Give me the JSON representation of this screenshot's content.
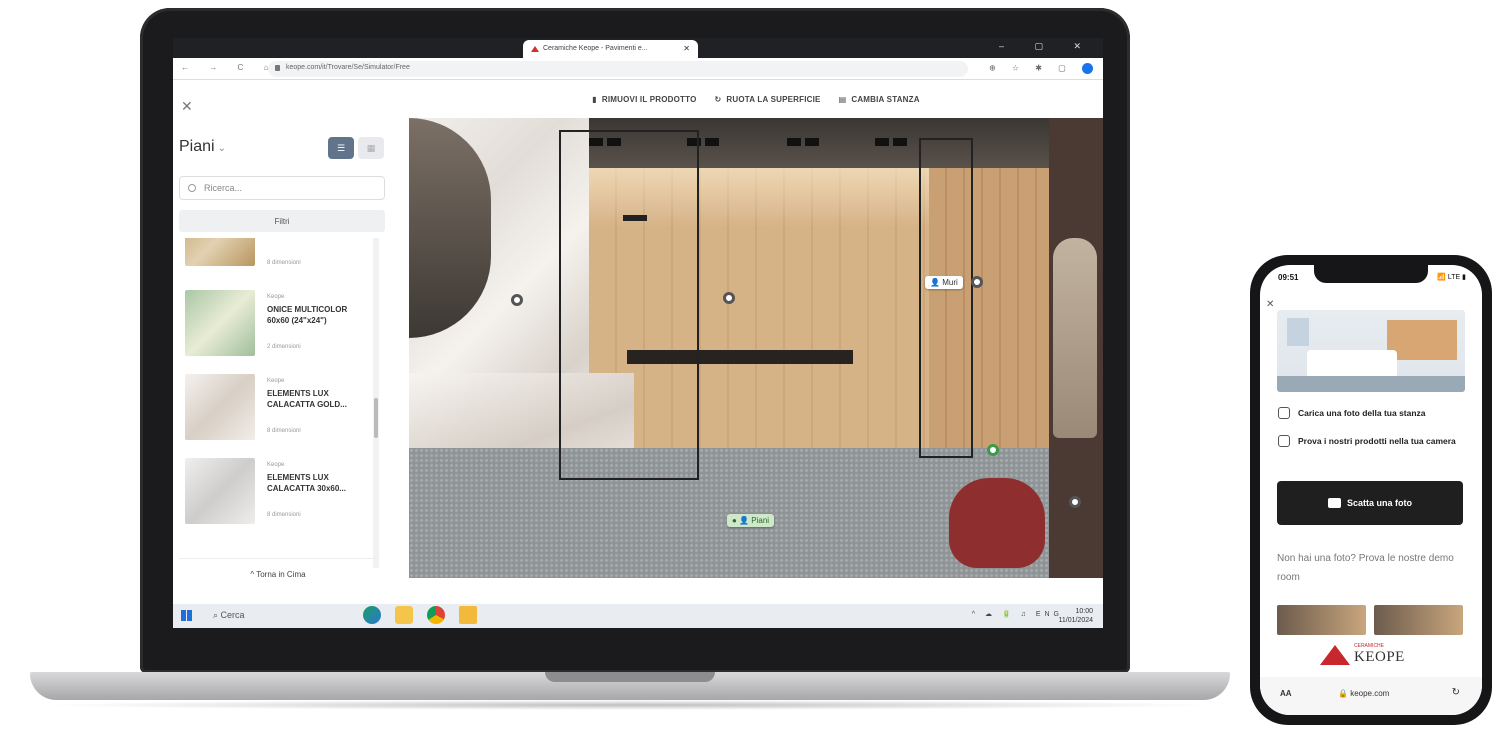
{
  "browser": {
    "tab_title": "Ceramiche Keope - Pavimenti e...",
    "url": "keope.com/it/Trovare/Se/Simulator/Free",
    "window_controls": "– ▢ ✕",
    "nav_buttons": "← → C ⌂",
    "extensions": "⊕ ☆ ✱ ▢",
    "avatar_initial": ""
  },
  "toolbar": {
    "remove_label": "RIMUOVI IL PRODOTTO",
    "rotate_label": "RUOTA LA SUPERFICIE",
    "change_room_label": "CAMBIA STANZA"
  },
  "panel": {
    "title": "Piani",
    "search_placeholder": "Ricerca...",
    "filters_label": "Filtri",
    "back_to_top_label": "Torna in Cima",
    "items": [
      {
        "brand": "",
        "name": "",
        "dims": "8 dimensioni",
        "color_a": "#c4a676",
        "color_b": "#e3d1b1"
      },
      {
        "brand": "Keope",
        "name": "ONICE MULTICOLOR 60x60 (24\"x24\")",
        "dims": "2 dimensioni",
        "color_a": "#aac7a5",
        "color_b": "#e8ecd5"
      },
      {
        "brand": "Keope",
        "name": "ELEMENTS LUX CALACATTA GOLD...",
        "dims": "8 dimensioni",
        "color_a": "#eeeae5",
        "color_b": "#d8cfc5"
      },
      {
        "brand": "Keope",
        "name": "ELEMENTS LUX CALACATTA 30x60...",
        "dims": "8 dimensioni",
        "color_a": "#f0efed",
        "color_b": "#cfcdcb"
      }
    ]
  },
  "room": {
    "hotspot_walls_label": "Muri",
    "hotspot_floor_label": "Piani"
  },
  "taskbar": {
    "search_label": "Cerca",
    "tray": "^ ☁ 🔋 ♫ ENG",
    "time": "10:00",
    "date": "11/01/2024"
  },
  "phone": {
    "time": "09:51",
    "signal": "📶 LTE ▮",
    "upload_label": "Carica una foto della tua stanza",
    "try_label": "Prova i nostri prodotti nella tua camera",
    "take_photo_label": "Scatta una foto",
    "demo_text": "Non hai una foto? Prova le nostre demo room",
    "logo_sub": "CERAMICHE",
    "logo_brand": "KEOPE",
    "aa_label": "AA",
    "url": "keope.com",
    "reload": "↻"
  }
}
